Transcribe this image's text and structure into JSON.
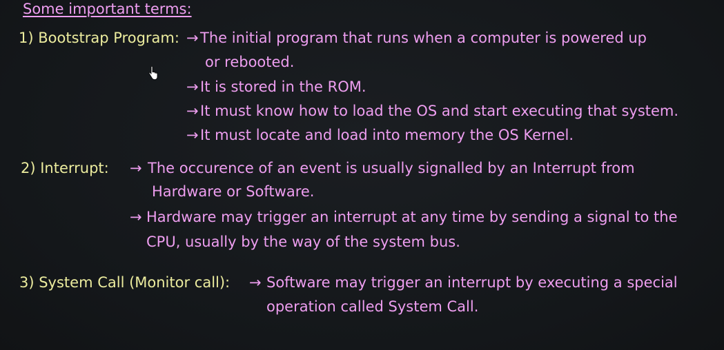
{
  "title": "Some important terms:",
  "terms": [
    {
      "label": "1) Bootstrap Program:",
      "points": [
        {
          "arrow": "→",
          "lines": [
            "The initial program that runs when a computer is powered up",
            "or rebooted."
          ]
        },
        {
          "arrow": "→",
          "lines": [
            "It is stored in the ROM."
          ]
        },
        {
          "arrow": "→",
          "lines": [
            "It must know how to load the OS and start executing that system."
          ]
        },
        {
          "arrow": "→",
          "lines": [
            "It must locate and load into memory the OS Kernel."
          ]
        }
      ]
    },
    {
      "label": "2) Interrupt:",
      "points": [
        {
          "arrow": "→",
          "lines": [
            "The occurence of an event is usually signalled by an Interrupt from",
            "Hardware or Software."
          ]
        },
        {
          "arrow": "→",
          "lines": [
            "Hardware may trigger an interrupt at any time by sending a signal to the",
            "CPU, usually by the way of the system bus."
          ]
        }
      ]
    },
    {
      "label": "3) System Call (Monitor call):",
      "points": [
        {
          "arrow": "→",
          "lines": [
            "Software may trigger an interrupt by executing a special",
            "operation called System Call."
          ]
        }
      ]
    }
  ],
  "colors": {
    "label": "#ecec9e",
    "definition": "#ee9ef0",
    "background": "#14171a"
  },
  "icons": {
    "cursor": "hand-pointer-icon"
  }
}
